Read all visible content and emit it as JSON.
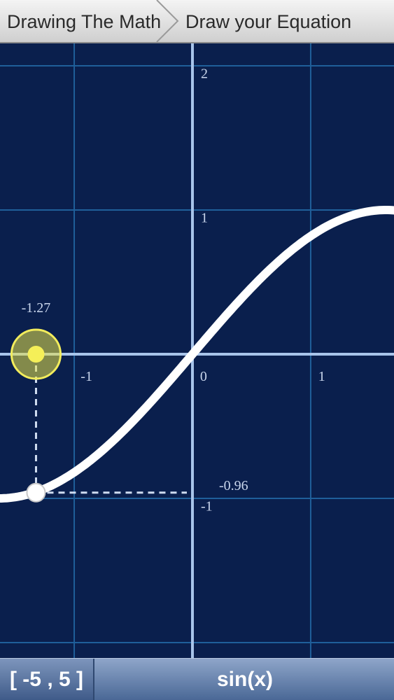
{
  "breadcrumb": {
    "home_label": "Drawing The Math",
    "current_label": "Draw your Equation"
  },
  "graph": {
    "x_ticks": [
      "-1",
      "0",
      "1"
    ],
    "y_ticks": [
      "2",
      "1",
      "-1"
    ],
    "cursor_x_label": "-1.27",
    "cursor_y_label": "-0.96",
    "colors": {
      "background": "#0a1f4d",
      "grid": "#1f5f9a",
      "axis": "#a8c4ea",
      "curve": "#ffffff",
      "handle": "#f2ec5c"
    }
  },
  "bottom": {
    "range_label": "[ -5 , 5 ]",
    "equation_label": "sin(x)"
  },
  "chart_data": {
    "type": "line",
    "series": [],
    "function": "sin(x)",
    "x_range": [
      -5,
      5
    ],
    "cursor": {
      "x": -1.27,
      "y": -0.96
    },
    "grid": true
  }
}
